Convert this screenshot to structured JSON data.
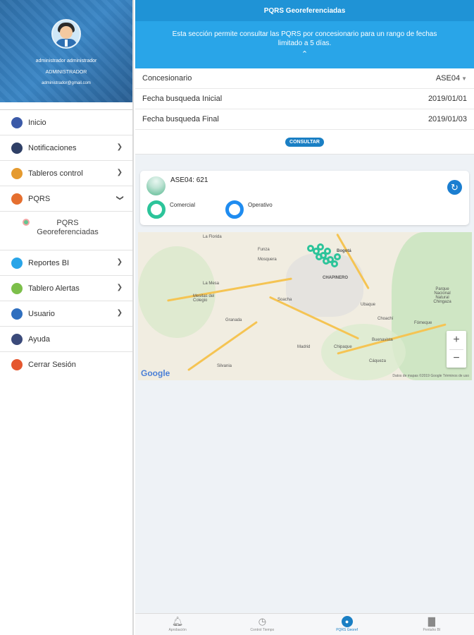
{
  "profile": {
    "name": "administrador administrador",
    "role": "ADMINISTRADOR",
    "email": "administrador@gmail.com"
  },
  "menu": {
    "items": [
      {
        "label": "Inicio",
        "icon": "home-chart-icon",
        "color": "#3b5aa8"
      },
      {
        "label": "Notificaciones",
        "icon": "bell-icon",
        "color": "#2f3f66"
      },
      {
        "label": "Tableros control",
        "icon": "dashboard-icon",
        "color": "#e59a2f"
      },
      {
        "label": "PQRS",
        "icon": "pqrs-icon",
        "color": "#e56f2f"
      },
      {
        "label": "Reportes BI",
        "icon": "report-icon",
        "color": "#29a5e8"
      },
      {
        "label": "Tablero Alertas",
        "icon": "alert-board-icon",
        "color": "#7cbf4a"
      },
      {
        "label": "Usuario",
        "icon": "user-icon",
        "color": "#2f6fbf"
      },
      {
        "label": "Ayuda",
        "icon": "help-icon",
        "color": "#3b4a7a"
      },
      {
        "label": "Cerrar Sesión",
        "icon": "logout-icon",
        "color": "#e5572f"
      }
    ],
    "sub_item": "PQRS Georeferenciadas"
  },
  "header": {
    "title": "PQRS Georeferenciadas",
    "description": "Esta sección permite consultar las PQRS por concesionario para un rango de fechas limitado a 5 días."
  },
  "form": {
    "concesionario_label": "Concesionario",
    "concesionario_value": "ASE04",
    "fecha_inicial_label": "Fecha busqueda Inicial",
    "fecha_inicial_value": "2019/01/01",
    "fecha_final_label": "Fecha busqueda Final",
    "fecha_final_value": "2019/01/03",
    "consultar_label": "CONSULTAR"
  },
  "card": {
    "title": "ASE04: 621",
    "legend_comercial": "Comercial",
    "legend_operativo": "Operativo",
    "colors": {
      "comercial": "#2cc49a",
      "operativo": "#1f8cf0"
    }
  },
  "map": {
    "labels": {
      "la_florida": "La Florida",
      "mosquera": "Mosquera",
      "funza": "Funza",
      "bogota": "Bogotá",
      "chapinero": "CHAPINERO",
      "la_mesa": "La Mesa",
      "soacha": "Soacha",
      "mesitas": "Mesitas del Colegio",
      "granada": "Granada",
      "silvania": "Silvania",
      "madrid": "Madrid",
      "chipaque": "Chipaque",
      "ubaque": "Ubaque",
      "choachi": "Choachí",
      "fomeque": "Fómeque",
      "buenavista": "Buenavista",
      "caqueza": "Cáqueza",
      "parque": "Parque Nacional Natural Chingaza"
    },
    "google": "Google",
    "attribution": "Datos de mapas ©2019 Google   Términos de uso",
    "zoom_in": "+",
    "zoom_out": "−"
  },
  "tabs": [
    {
      "label": "Aprobación",
      "icon": "bell-outline-icon"
    },
    {
      "label": "Control Tiempo",
      "icon": "clock-icon"
    },
    {
      "label": "PQRS Georef",
      "icon": "map-pin-icon"
    },
    {
      "label": "Pentaho BI",
      "icon": "bar-chart-icon"
    }
  ]
}
